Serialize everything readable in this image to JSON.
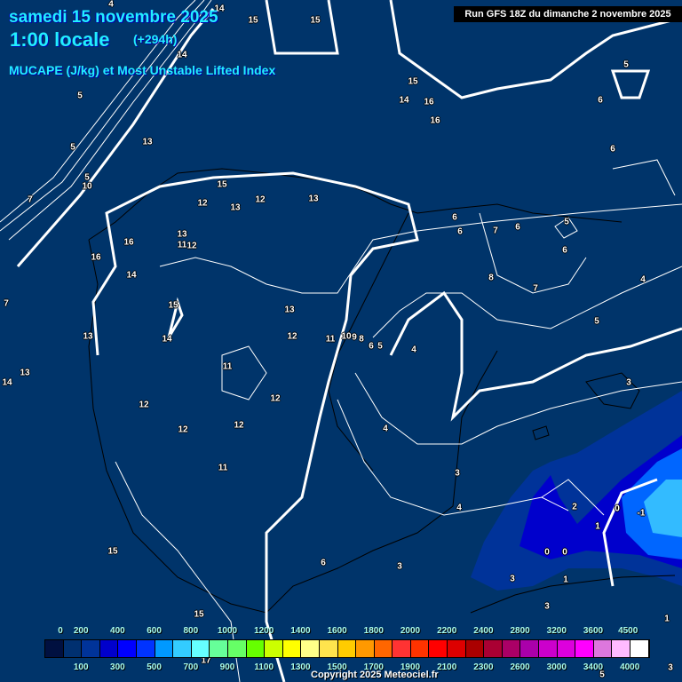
{
  "header": {
    "date": "samedi 15 novembre 2025",
    "time": "1:00 locale",
    "lead": "(+294h)",
    "parameter": "MUCAPE (J/kg) et Most Unstable Lifted Index",
    "run": "Run GFS 18Z du dimanche 2 novembre 2025"
  },
  "contour_labels": [
    "4",
    "14",
    "15",
    "15",
    "14",
    "5",
    "5",
    "13",
    "5",
    "10",
    "7",
    "15",
    "14",
    "16",
    "16",
    "5",
    "6",
    "6",
    "15",
    "12",
    "13",
    "12",
    "13",
    "16",
    "16",
    "14",
    "13",
    "11",
    "12",
    "6",
    "6",
    "7",
    "6",
    "5",
    "6",
    "8",
    "7",
    "4",
    "7",
    "15",
    "13",
    "5",
    "13",
    "14",
    "12",
    "11",
    "10",
    "9",
    "8",
    "6",
    "5",
    "4",
    "11",
    "13",
    "14",
    "3",
    "12",
    "12",
    "12",
    "12",
    "4",
    "11",
    "3",
    "4",
    "2",
    "0",
    "-1",
    "1",
    "15",
    "0",
    "0",
    "6",
    "3",
    "3",
    "1",
    "3",
    "15",
    "1",
    "4",
    "5",
    "3",
    "17"
  ],
  "legend": {
    "unit": "J/kg",
    "colors": [
      "#001040",
      "#003070",
      "#003399",
      "#0000cc",
      "#0000ff",
      "#0033ff",
      "#0099ff",
      "#33ccff",
      "#66ffff",
      "#66ff99",
      "#66ff66",
      "#66ff00",
      "#ccff00",
      "#ffff00",
      "#ffff88",
      "#ffe44d",
      "#ffcc00",
      "#ff9900",
      "#ff6600",
      "#ff3333",
      "#ff3300",
      "#ff0000",
      "#dd0000",
      "#aa0000",
      "#aa0033",
      "#aa0066",
      "#aa00aa",
      "#cc00cc",
      "#dd00dd",
      "#ff00ff",
      "#dd77dd",
      "#ffbbff",
      "#ffffff"
    ],
    "top_labels": [
      "0",
      "200",
      "400",
      "600",
      "800",
      "1000",
      "1200",
      "1400",
      "1600",
      "1800",
      "2000",
      "2200",
      "2400",
      "2800",
      "3200",
      "3600",
      "4500"
    ],
    "bottom_labels": [
      "100",
      "300",
      "500",
      "700",
      "900",
      "1100",
      "1300",
      "1500",
      "1700",
      "1900",
      "2100",
      "2300",
      "2600",
      "3000",
      "3400",
      "4000"
    ]
  },
  "copyright": "Copyright 2025 Meteociel.fr"
}
